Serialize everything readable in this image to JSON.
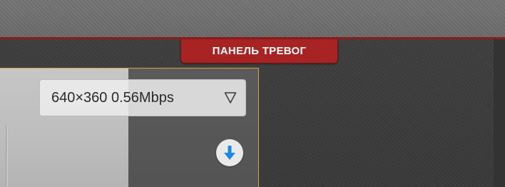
{
  "alarm_panel": {
    "tab_label": "ПАНЕЛЬ ТРЕВОГ"
  },
  "video_cell": {
    "stream_select": {
      "resolution": "640×360",
      "bitrate": "0.56Mbps",
      "arrow_icon": "triangle-down-outline-icon"
    },
    "download_button": {
      "icon": "download-arrow-icon",
      "accent": "#1e88e5"
    }
  },
  "colors": {
    "alarm_tab": "#a82424",
    "cell_border": "#d4a33a",
    "divider": "#8b1c1c"
  }
}
